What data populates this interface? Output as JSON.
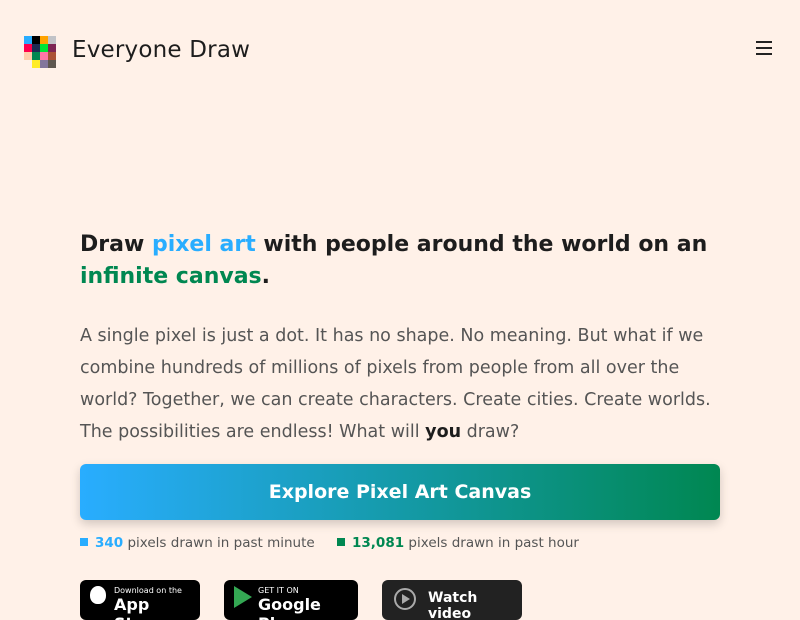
{
  "header": {
    "brand": "Everyone Draw",
    "menu_icon": "hamburger-menu-icon",
    "logo_colors": [
      "#29adff",
      "#000000",
      "#ffa300",
      "#c2c3c7",
      "#ff004d",
      "#1d2b53",
      "#00e436",
      "#7e2553",
      "#ffccaa",
      "#008751",
      "#ff77a8",
      "#ab5236",
      "#fff1e8",
      "#ffec27",
      "#83769c",
      "#5f574f"
    ]
  },
  "hero": {
    "headline_1": "Draw ",
    "headline_2": "pixel art",
    "headline_3": " with people around the world on an ",
    "headline_4": "infinite canvas",
    "headline_5": ".",
    "para_1": "A single pixel is just a dot. It has no shape. No meaning. But what if we combine hundreds of millions of pixels from people from all over the world? Together, we can create characters. Create cities. Create worlds. The possibilities are endless! What will ",
    "para_bold": "you",
    "para_2": " draw?"
  },
  "cta": {
    "label": "Explore Pixel Art Canvas"
  },
  "stats": [
    {
      "value": "340",
      "label": "pixels drawn in past minute",
      "color": "#29adff"
    },
    {
      "value": "13,081",
      "label": "pixels drawn in past hour",
      "color": "#008751"
    }
  ],
  "stores": {
    "appstore_small": "Download on the",
    "appstore_big": "App Store",
    "googleplay_small": "GET IT ON",
    "googleplay_big": "Google Play",
    "watch_label": "Watch video"
  }
}
